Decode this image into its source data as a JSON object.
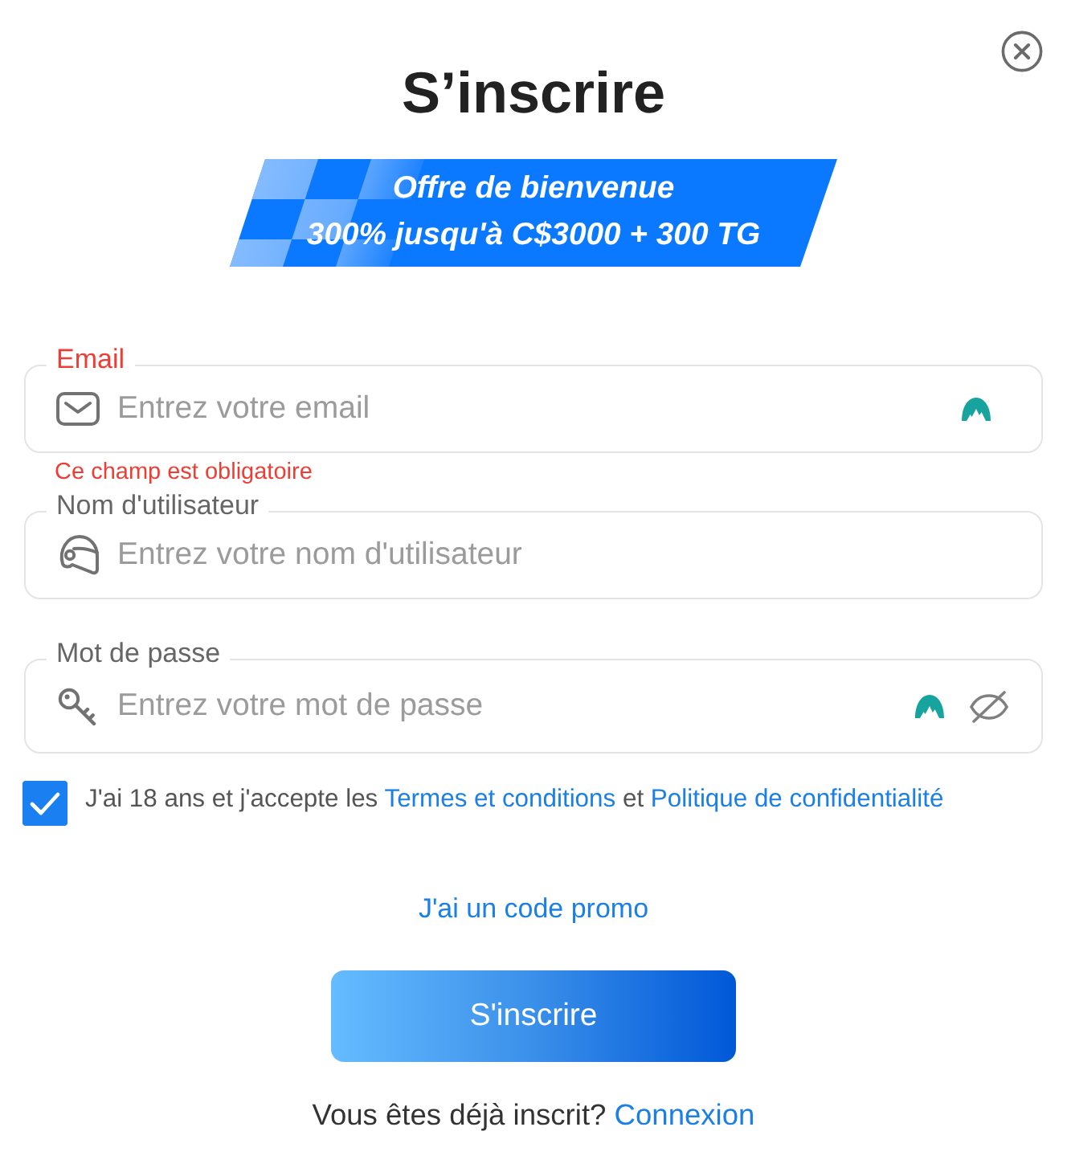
{
  "title": "S’inscrire",
  "banner": {
    "lines": [
      "Offre de bienvenue",
      "300% jusqu'à C$3000 + 300 TG"
    ]
  },
  "fields": [
    {
      "kind": "email",
      "label": "Email",
      "placeholder": "Entrez votre email",
      "invalid": true,
      "error": "Ce champ est obligatoire",
      "autofill_badge": true
    },
    {
      "kind": "username",
      "label": "Nom d'utilisateur",
      "placeholder": "Entrez votre nom d'utilisateur",
      "invalid": false,
      "autofill_badge": false
    },
    {
      "kind": "password",
      "label": "Mot de passe",
      "placeholder": "Entrez votre mot de passe",
      "invalid": false,
      "autofill_badge": true,
      "masked": true
    }
  ],
  "consent": {
    "checked": true,
    "parts": [
      {
        "kind": "text",
        "text": "J'ai 18 ans et j'accepte les"
      },
      {
        "kind": "link",
        "text": "Termes et conditions"
      },
      {
        "kind": "text",
        "text": "et"
      },
      {
        "kind": "link",
        "text": "Politique de confidentialité"
      }
    ]
  },
  "promo_link": "J'ai un code promo",
  "submit_button": "S'inscrire",
  "login_prompt": {
    "text": "Vous êtes déjà inscrit?",
    "link": "Connexion"
  }
}
